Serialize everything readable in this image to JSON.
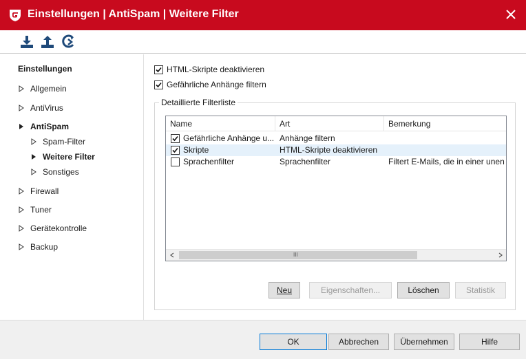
{
  "window": {
    "title": "Einstellungen | AntiSpam | Weitere Filter",
    "brand_color": "#c80a1e"
  },
  "toolbar": {
    "buttons": [
      {
        "name": "import-icon"
      },
      {
        "name": "export-icon"
      },
      {
        "name": "reset-icon"
      }
    ]
  },
  "sidebar": {
    "heading": "Einstellungen",
    "items": [
      {
        "label": "Allgemein"
      },
      {
        "label": "AntiVirus"
      },
      {
        "label": "AntiSpam"
      },
      {
        "label": "Spam-Filter"
      },
      {
        "label": "Weitere Filter"
      },
      {
        "label": "Sonstiges"
      },
      {
        "label": "Firewall"
      },
      {
        "label": "Tuner"
      },
      {
        "label": "Gerätekontrolle"
      },
      {
        "label": "Backup"
      }
    ]
  },
  "main": {
    "options": [
      {
        "label": "HTML-Skripte deaktivieren",
        "checked": true
      },
      {
        "label": "Gefährliche Anhänge filtern",
        "checked": true
      }
    ],
    "filter_group": {
      "title": "Detaillierte Filterliste",
      "columns": [
        "Name",
        "Art",
        "Bemerkung"
      ],
      "rows": [
        {
          "name": "Gefährliche Anhänge u...",
          "art": "Anhänge filtern",
          "bemerkung": "",
          "checked": true
        },
        {
          "name": "Skripte",
          "art": "HTML-Skripte deaktivieren",
          "bemerkung": "",
          "checked": true
        },
        {
          "name": "Sprachenfilter",
          "art": "Sprachenfilter",
          "bemerkung": "Filtert E-Mails, die in einer unen",
          "checked": false
        }
      ],
      "scroll_grip": "III",
      "buttons": {
        "neu": "Neu",
        "eigenschaften": "Eigenschaften...",
        "loeschen": "Löschen",
        "statistik": "Statistik"
      }
    }
  },
  "footer": {
    "ok": "OK",
    "abbrechen": "Abbrechen",
    "uebernehmen": "Übernehmen",
    "hilfe": "Hilfe"
  }
}
